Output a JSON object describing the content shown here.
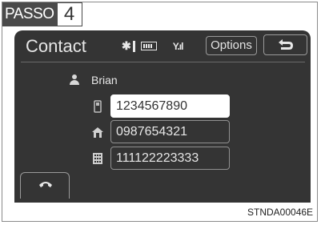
{
  "step": {
    "label": "PASSO",
    "number": "4"
  },
  "screen": {
    "title": "Contact",
    "options_label": "Options",
    "contact_name": "Brian",
    "numbers": [
      {
        "type": "mobile",
        "icon": "mobile-phone-icon",
        "value": "1234567890",
        "selected": true
      },
      {
        "type": "home",
        "icon": "home-icon",
        "value": "0987654321",
        "selected": false
      },
      {
        "type": "office",
        "icon": "office-building-icon",
        "value": "111122223333",
        "selected": false
      }
    ],
    "icons": [
      "bluetooth-icon",
      "battery-icon",
      "signal-icon",
      "back-arrow-icon",
      "person-icon",
      "phone-handset-icon"
    ]
  },
  "caption": "STNDA00046E"
}
